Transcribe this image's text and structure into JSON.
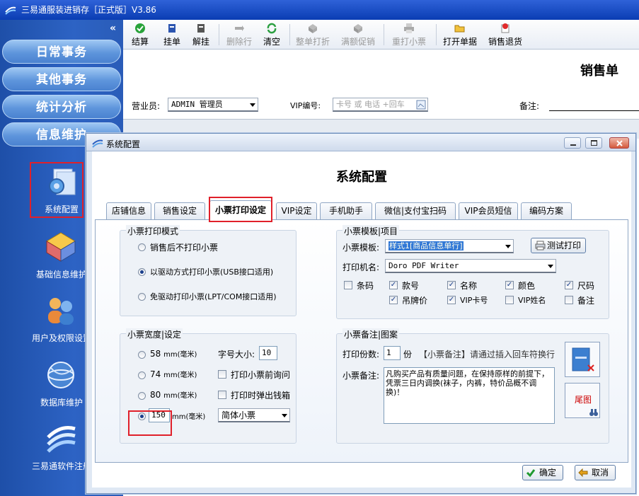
{
  "app": {
    "title": "三易通服装进销存［正式版］V3.86"
  },
  "sidebar": {
    "collapse_glyph": "«",
    "nav": [
      "日常事务",
      "其他事务",
      "统计分析",
      "信息维护"
    ],
    "items": [
      {
        "label": "系统配置",
        "icon": "system-config-icon"
      },
      {
        "label": "基础信息维护",
        "icon": "basic-info-icon"
      },
      {
        "label": "用户及权限设置",
        "icon": "users-icon"
      },
      {
        "label": "数据库维护",
        "icon": "database-icon"
      },
      {
        "label": "三易通软件注册",
        "icon": "register-icon"
      }
    ]
  },
  "toolbar": {
    "buttons": [
      {
        "label": "结算",
        "icon": "check-icon",
        "enabled": true
      },
      {
        "label": "挂单",
        "icon": "pin-icon",
        "enabled": true
      },
      {
        "label": "解挂",
        "icon": "unpin-icon",
        "enabled": true
      },
      {
        "label": "删除行",
        "icon": "delete-row-icon",
        "enabled": false
      },
      {
        "label": "清空",
        "icon": "refresh-icon",
        "enabled": true
      },
      {
        "label": "整单打折",
        "icon": "discount-icon",
        "enabled": false
      },
      {
        "label": "满额促销",
        "icon": "promo-icon",
        "enabled": false
      },
      {
        "label": "重打小票",
        "icon": "printer-icon",
        "enabled": false
      },
      {
        "label": "打开单据",
        "icon": "folder-open-icon",
        "enabled": true
      },
      {
        "label": "销售退货",
        "icon": "return-icon",
        "enabled": true
      }
    ]
  },
  "sales": {
    "title": "销售单",
    "clerk_label": "营业员:",
    "clerk_value": "ADMIN 管理员",
    "vip_label": "VIP编号:",
    "vip_placeholder": "卡号 或 电话 +回车",
    "note_label": "备注:"
  },
  "dialog": {
    "window_title": "系统配置",
    "heading": "系统配置",
    "tabs": [
      "店铺信息",
      "销售设定",
      "小票打印设定",
      "VIP设定",
      "手机助手",
      "微信|支付宝扫码",
      "VIP会员短信",
      "编码方案"
    ],
    "active_tab": "小票打印设定",
    "print_mode": {
      "title": "小票打印模式",
      "options": [
        "销售后不打印小票",
        "以驱动方式打印小票(USB接口适用)",
        "免驱动打印小票(LPT/COM接口适用)"
      ],
      "selected": 1
    },
    "ticket_width": {
      "title": "小票宽度|设定",
      "options": [
        "58",
        "74",
        "80"
      ],
      "unit": "mm(毫米)",
      "custom_width": "150",
      "selected": 3,
      "font_size_label": "字号大小:",
      "font_size": "10",
      "check_print_inquiry": "打印小票前询问",
      "check_cash_drawer": "打印时弹出钱箱",
      "font_style": "简体小票"
    },
    "template": {
      "title": "小票模板|项目",
      "template_label": "小票模板:",
      "template_value": "样式1[商品信息单行]",
      "test_print": "测试打印",
      "printer_label": "打印机名:",
      "printer_value": "Doro PDF Writer",
      "fields": [
        {
          "label": "条码",
          "checked": false
        },
        {
          "label": "款号",
          "checked": true
        },
        {
          "label": "名称",
          "checked": true
        },
        {
          "label": "颜色",
          "checked": true
        },
        {
          "label": "尺码",
          "checked": true
        },
        {
          "label": "吊牌价",
          "checked": true
        },
        {
          "label": "VIP卡号",
          "checked": true
        },
        {
          "label": "VIP姓名",
          "checked": false
        },
        {
          "label": "备注",
          "checked": false
        }
      ]
    },
    "remark": {
      "title": "小票备注|图案",
      "copies_label": "打印份数:",
      "copies": "1",
      "copies_unit": "份",
      "hint": "【小票备注】请通过插入回车符换行",
      "remark_label": "小票备注:",
      "remark_text": "凡购买产品有质量问题，在保持原样的前提下，凭票三日内调换(袜子，内裤，特价品概不调换)！",
      "tail_image_label": "尾图"
    },
    "ok": "确定",
    "cancel": "取消"
  }
}
